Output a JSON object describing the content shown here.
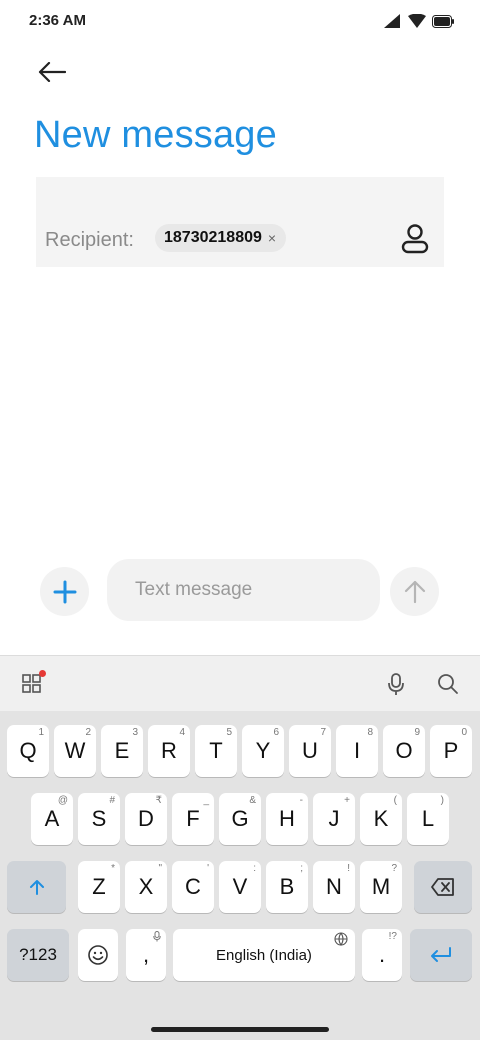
{
  "status_bar": {
    "time": "2:36 AM"
  },
  "header": {
    "title": "New message"
  },
  "recipient": {
    "label": "Recipient:",
    "chip": "18730218809",
    "chip_close": "×"
  },
  "compose": {
    "placeholder": "Text message"
  },
  "keyboard": {
    "row1": [
      {
        "label": "Q",
        "hint": "1"
      },
      {
        "label": "W",
        "hint": "2"
      },
      {
        "label": "E",
        "hint": "3"
      },
      {
        "label": "R",
        "hint": "4"
      },
      {
        "label": "T",
        "hint": "5"
      },
      {
        "label": "Y",
        "hint": "6"
      },
      {
        "label": "U",
        "hint": "7"
      },
      {
        "label": "I",
        "hint": "8"
      },
      {
        "label": "O",
        "hint": "9"
      },
      {
        "label": "P",
        "hint": "0"
      }
    ],
    "row2": [
      {
        "label": "A",
        "hint": "@"
      },
      {
        "label": "S",
        "hint": "#"
      },
      {
        "label": "D",
        "hint": "₹"
      },
      {
        "label": "F",
        "hint": "_"
      },
      {
        "label": "G",
        "hint": "&"
      },
      {
        "label": "H",
        "hint": "-"
      },
      {
        "label": "J",
        "hint": "+"
      },
      {
        "label": "K",
        "hint": "("
      },
      {
        "label": "L",
        "hint": ")"
      }
    ],
    "row3": [
      {
        "label": "Z",
        "hint": "*"
      },
      {
        "label": "X",
        "hint": "\""
      },
      {
        "label": "C",
        "hint": "'"
      },
      {
        "label": "V",
        "hint": ":"
      },
      {
        "label": "B",
        "hint": ";"
      },
      {
        "label": "N",
        "hint": "!"
      },
      {
        "label": "M",
        "hint": "?"
      }
    ],
    "symbols_key": "?123",
    "comma_key": ",",
    "space_key": "English (India)",
    "period_key": ".",
    "period_hint": "!?",
    "accent_color": "#1f8fe0"
  }
}
